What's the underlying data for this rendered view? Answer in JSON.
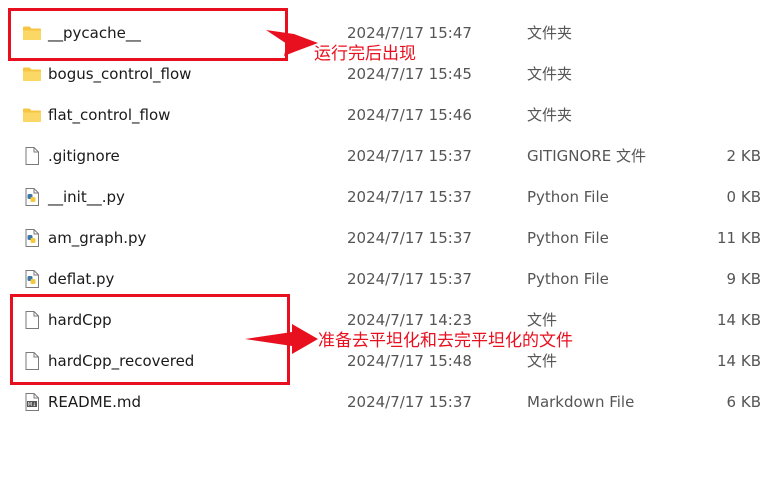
{
  "files": [
    {
      "name": "__pycache__",
      "date": "2024/7/17 15:47",
      "type": "文件夹",
      "size": "",
      "icon": "folder-icon"
    },
    {
      "name": "bogus_control_flow",
      "date": "2024/7/17 15:45",
      "type": "文件夹",
      "size": "",
      "icon": "folder-icon"
    },
    {
      "name": "flat_control_flow",
      "date": "2024/7/17 15:46",
      "type": "文件夹",
      "size": "",
      "icon": "folder-icon"
    },
    {
      "name": ".gitignore",
      "date": "2024/7/17 15:37",
      "type": "GITIGNORE 文件",
      "size": "2 KB",
      "icon": "file-icon"
    },
    {
      "name": "__init__.py",
      "date": "2024/7/17 15:37",
      "type": "Python File",
      "size": "0 KB",
      "icon": "python-file-icon"
    },
    {
      "name": "am_graph.py",
      "date": "2024/7/17 15:37",
      "type": "Python File",
      "size": "11 KB",
      "icon": "python-file-icon"
    },
    {
      "name": "deflat.py",
      "date": "2024/7/17 15:37",
      "type": "Python File",
      "size": "9 KB",
      "icon": "python-file-icon"
    },
    {
      "name": "hardCpp",
      "date": "2024/7/17 14:23",
      "type": "文件",
      "size": "14 KB",
      "icon": "file-icon"
    },
    {
      "name": "hardCpp_recovered",
      "date": "2024/7/17 15:48",
      "type": "文件",
      "size": "14 KB",
      "icon": "file-icon"
    },
    {
      "name": "README.md",
      "date": "2024/7/17 15:37",
      "type": "Markdown File",
      "size": "6 KB",
      "icon": "markdown-file-icon"
    }
  ],
  "annotations": {
    "pycache_note": "运行完后出现",
    "hardcpp_note": "准备去平坦化和去完平坦化的文件"
  },
  "colors": {
    "annotation": "#e8101e",
    "folder": "#f5c543",
    "python_blue": "#3b77a8",
    "python_yellow": "#f3c93f"
  }
}
